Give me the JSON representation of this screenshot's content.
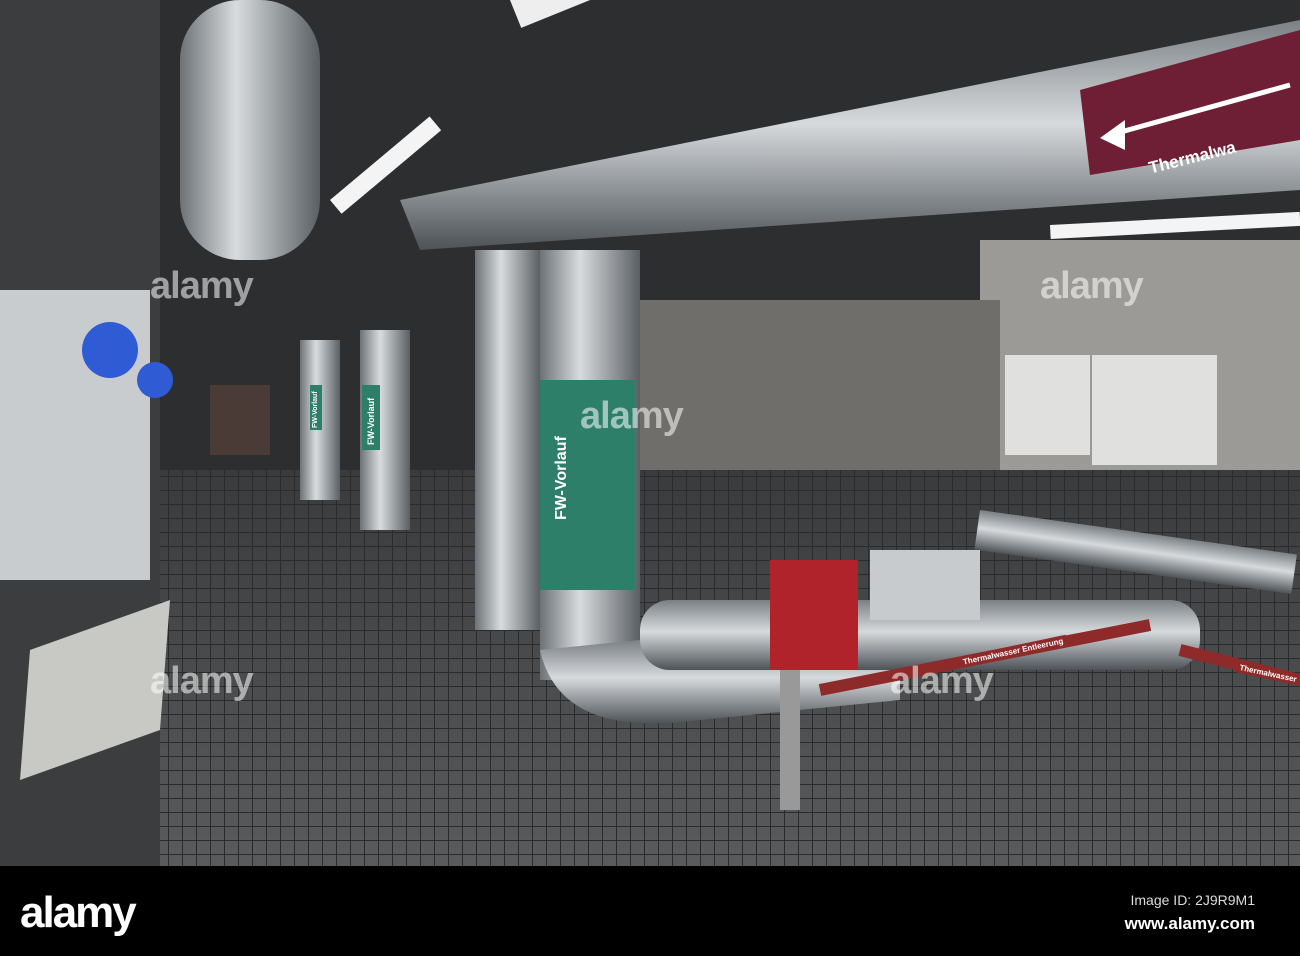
{
  "photo": {
    "pipe_labels": {
      "fw_vorlauf_main": "FW-Vorlauf",
      "fw_vorlauf_2": "FW-Vorlauf",
      "fw_vorlauf_3": "FW-Vorlauf",
      "thermalwasser_sign": "Thermalwa",
      "entleerung": "Thermalwasser Entleerung",
      "thermalwasser_right": "Thermalwasser"
    },
    "watermark": "alamy"
  },
  "footer": {
    "logo": "alamy",
    "image_id": "Image ID: 2J9R9M1",
    "url": "www.alamy.com"
  }
}
